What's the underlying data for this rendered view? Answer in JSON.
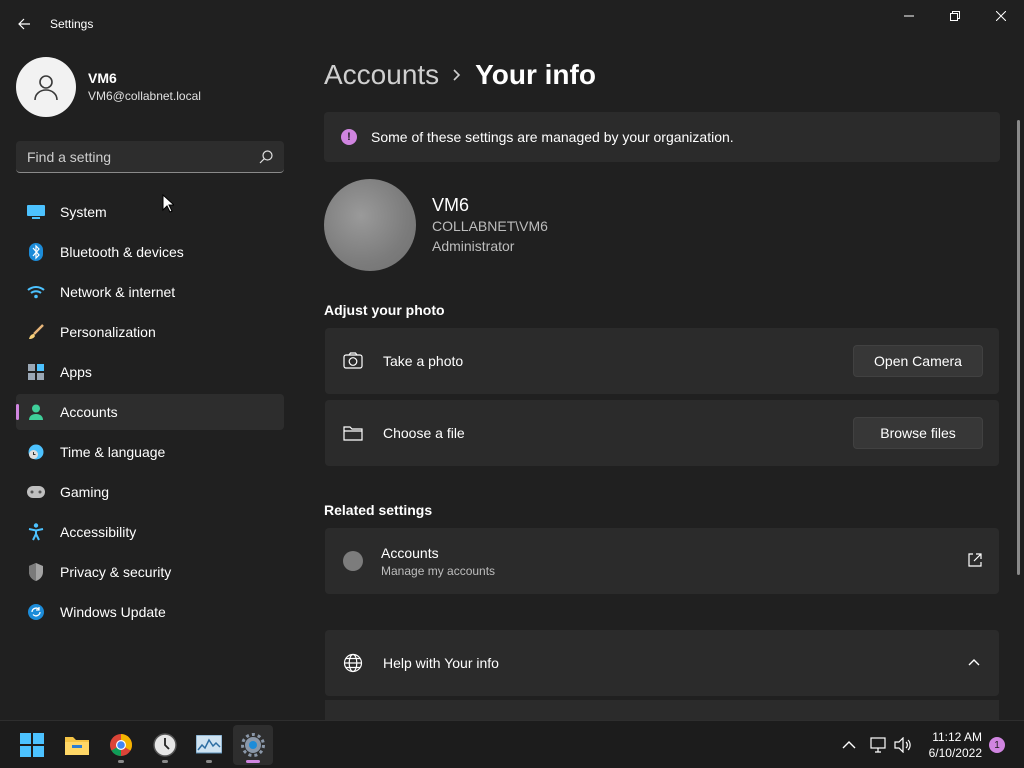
{
  "window": {
    "title": "Settings",
    "controls": [
      "minimize",
      "restore",
      "close"
    ]
  },
  "profile": {
    "name": "VM6",
    "email": "VM6@collabnet.local"
  },
  "search": {
    "placeholder": "Find a setting"
  },
  "sidebar": {
    "items": [
      {
        "label": "System",
        "icon": "system-icon",
        "active": false
      },
      {
        "label": "Bluetooth & devices",
        "icon": "bluetooth-icon",
        "active": false
      },
      {
        "label": "Network & internet",
        "icon": "wifi-icon",
        "active": false
      },
      {
        "label": "Personalization",
        "icon": "brush-icon",
        "active": false
      },
      {
        "label": "Apps",
        "icon": "apps-icon",
        "active": false
      },
      {
        "label": "Accounts",
        "icon": "accounts-icon",
        "active": true
      },
      {
        "label": "Time & language",
        "icon": "clock-globe-icon",
        "active": false
      },
      {
        "label": "Gaming",
        "icon": "gamepad-icon",
        "active": false
      },
      {
        "label": "Accessibility",
        "icon": "accessibility-icon",
        "active": false
      },
      {
        "label": "Privacy & security",
        "icon": "shield-icon",
        "active": false
      },
      {
        "label": "Windows Update",
        "icon": "update-icon",
        "active": false
      }
    ]
  },
  "breadcrumb": {
    "parent": "Accounts",
    "current": "Your info"
  },
  "notice": {
    "text": "Some of these settings are managed by your organization."
  },
  "user": {
    "name": "VM6",
    "domain": "COLLABNET\\VM6",
    "role": "Administrator"
  },
  "adjust_photo": {
    "title": "Adjust your photo",
    "take_photo_label": "Take a photo",
    "open_camera_button": "Open Camera",
    "choose_file_label": "Choose a file",
    "browse_files_button": "Browse files"
  },
  "related": {
    "title": "Related settings",
    "accounts_label": "Accounts",
    "accounts_sub": "Manage my accounts"
  },
  "help": {
    "label": "Help with Your info"
  },
  "taskbar": {
    "apps": [
      "start",
      "file-explorer",
      "chrome",
      "clock-app",
      "resource-monitor",
      "settings"
    ],
    "time": "11:12 AM",
    "date": "6/10/2022",
    "notification_count": "1"
  },
  "colors": {
    "accent": "#d085e0",
    "background": "#202020",
    "card": "#2b2b2b"
  }
}
